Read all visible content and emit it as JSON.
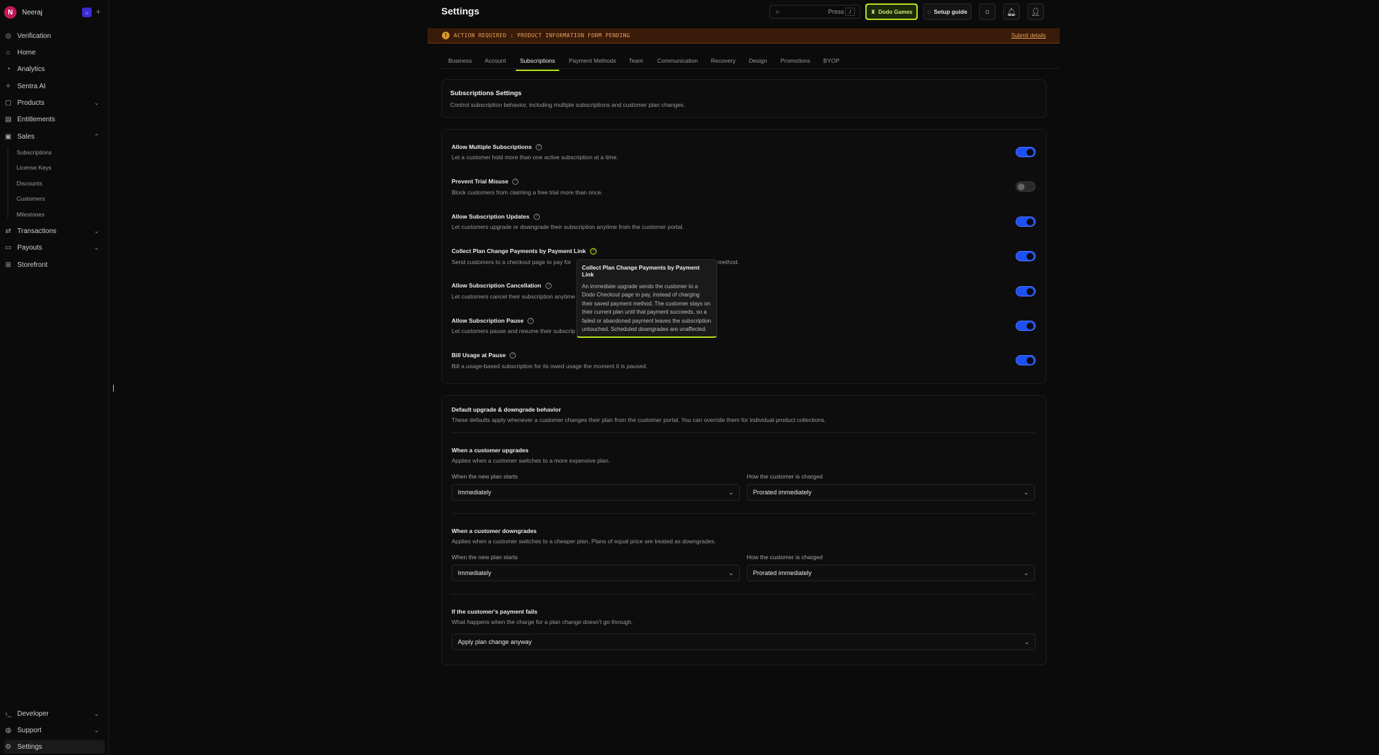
{
  "org": {
    "initial": "N",
    "name": "Neeraj",
    "badge": "⌂",
    "add": "+"
  },
  "sidebar": {
    "items": [
      {
        "label": "Verification",
        "icon": "verification-icon"
      },
      {
        "label": "Home",
        "icon": "home-icon"
      },
      {
        "label": "Analytics",
        "icon": "analytics-icon"
      },
      {
        "label": "Sentra AI",
        "icon": "sparkle-icon"
      },
      {
        "label": "Products",
        "icon": "box-icon"
      },
      {
        "label": "Entitlements",
        "icon": "entitlements-icon"
      },
      {
        "label": "Sales",
        "icon": "sales-icon"
      },
      {
        "label": "Transactions",
        "icon": "transactions-icon"
      },
      {
        "label": "Payouts",
        "icon": "payouts-icon"
      },
      {
        "label": "Storefront",
        "icon": "storefront-icon"
      }
    ],
    "sales_sub": [
      "Subscriptions",
      "License Keys",
      "Discounts",
      "Customers",
      "Milestones"
    ],
    "bottom": [
      {
        "label": "Developer",
        "icon": "code-icon"
      },
      {
        "label": "Support",
        "icon": "support-icon"
      },
      {
        "label": "Settings",
        "icon": "gear-icon"
      }
    ]
  },
  "header": {
    "title": "Settings",
    "search_press": "Press",
    "search_key": "/",
    "dodo_label": "Dodo Games",
    "setup_label": "Setup guide"
  },
  "banner": {
    "text": "ACTION REQUIRED : PRODUCT INFORMATION FORM PENDING",
    "link": "Submit details"
  },
  "tabs": [
    "Business",
    "Account",
    "Subscriptions",
    "Payment Methods",
    "Team",
    "Communication",
    "Recovery",
    "Design",
    "Promotions",
    "BYOP"
  ],
  "subs_card": {
    "title": "Subscriptions Settings",
    "subtitle": "Control subscription behavior, including multiple subscriptions and customer plan changes."
  },
  "settings": [
    {
      "title": "Allow Multiple Subscriptions",
      "desc": "Let a customer hold more than one active subscription at a time.",
      "on": true
    },
    {
      "title": "Prevent Trial Misuse",
      "desc": "Block customers from claiming a free trial more than once.",
      "on": false
    },
    {
      "title": "Allow Subscription Updates",
      "desc": "Let customers upgrade or downgrade their subscription anytime from the customer portal.",
      "on": true
    },
    {
      "title": "Collect Plan Change Payments by Payment Link",
      "desc_left": "Send customers to a checkout page to pay for",
      "desc_right": "method.",
      "on": true
    },
    {
      "title": "Allow Subscription Cancellation",
      "desc": "Let customers cancel their subscription anytime",
      "on": true
    },
    {
      "title": "Allow Subscription Pause",
      "desc": "Let customers pause and resume their subscrip",
      "on": true
    },
    {
      "title": "Bill Usage at Pause",
      "desc": "Bill a usage-based subscription for its owed usage the moment it is paused.",
      "on": true
    }
  ],
  "tooltip": {
    "title": "Collect Plan Change Payments by Payment Link",
    "body": "An immediate upgrade sends the customer to a Dodo Checkout page to pay, instead of charging their saved payment method. The customer stays on their current plan until that payment succeeds, so a failed or abandoned payment leaves the subscription untouched. Scheduled downgrades are unaffected."
  },
  "defaults": {
    "title": "Default upgrade & downgrade behavior",
    "subtitle": "These defaults apply whenever a customer changes their plan from the customer portal. You can override them for individual product collections.",
    "upgrades": {
      "title": "When a customer upgrades",
      "desc": "Applies when a customer switches to a more expensive plan.",
      "start_label": "When the new plan starts",
      "start_value": "Immediately",
      "charge_label": "How the customer is charged",
      "charge_value": "Prorated immediately"
    },
    "downgrades": {
      "title": "When a customer downgrades",
      "desc": "Applies when a customer switches to a cheaper plan. Plans of equal price are treated as downgrades.",
      "start_label": "When the new plan starts",
      "start_value": "Immediately",
      "charge_label": "How the customer is charged",
      "charge_value": "Prorated immediately"
    },
    "fails": {
      "title": "If the customer's payment fails",
      "desc": "What happens when the charge for a plan change doesn't go through.",
      "value": "Apply plan change anyway"
    }
  },
  "colors": {
    "accent": "#b7e31b",
    "toggle_on": "#1d4ff2",
    "banner_bg": "#3a1a08",
    "banner_text": "#e0a45a"
  }
}
